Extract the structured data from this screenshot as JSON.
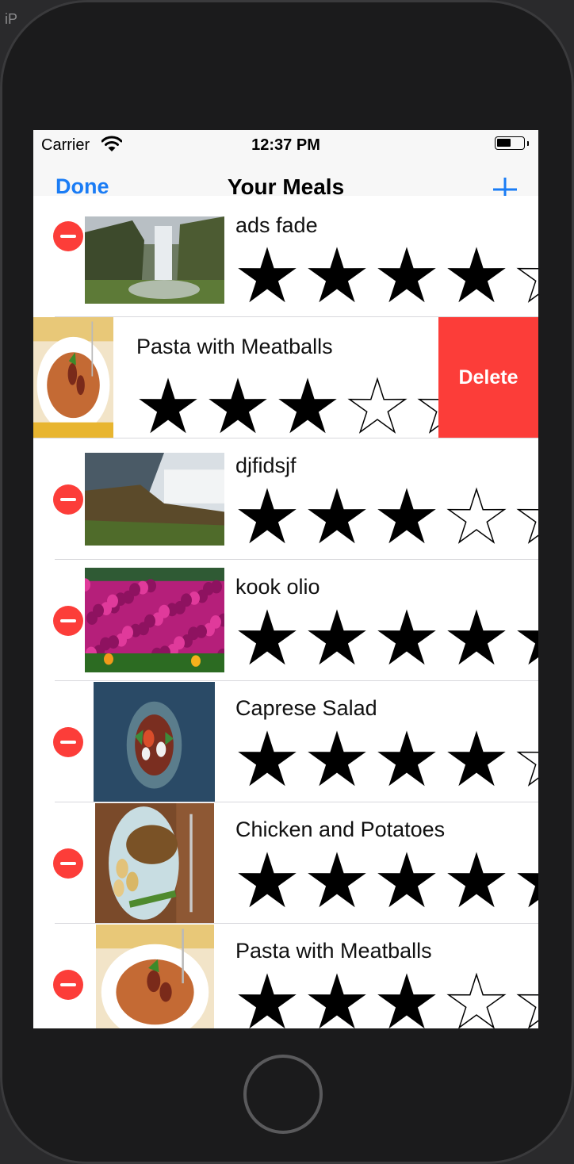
{
  "status_bar": {
    "carrier": "Carrier",
    "time": "12:37 PM",
    "battery_level": 0.55
  },
  "nav": {
    "left_button": "Done",
    "title": "Your Meals",
    "right_icon": "plus-icon"
  },
  "delete_button": {
    "label": "Delete"
  },
  "meals": [
    {
      "name": "ads fade",
      "rating": 4,
      "image": "waterfall-photo",
      "editing": true
    },
    {
      "name": "Pasta with Meatballs",
      "rating": 3,
      "image": "pasta-photo",
      "swiped": true
    },
    {
      "name": "djfidsjf",
      "rating": 3,
      "image": "waterfall-cliff-photo",
      "editing": true
    },
    {
      "name": "kook olio",
      "rating": 5,
      "image": "flowers-photo",
      "editing": true
    },
    {
      "name": "Caprese Salad",
      "rating": 4,
      "image": "salad-photo",
      "editing": true
    },
    {
      "name": "Chicken and Potatoes",
      "rating": 5,
      "image": "chicken-photo",
      "editing": true
    },
    {
      "name": "Pasta with Meatballs",
      "rating": 3,
      "image": "pasta-photo",
      "editing": true
    }
  ],
  "colors": {
    "accent": "#1a7cf5",
    "destructive": "#fc3d39"
  }
}
